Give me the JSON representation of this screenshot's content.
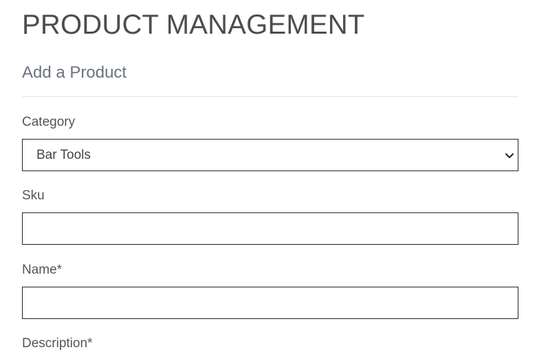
{
  "header": {
    "title": "PRODUCT MANAGEMENT"
  },
  "form": {
    "section_title": "Add a Product",
    "category": {
      "label": "Category",
      "selected_value": "Bar Tools"
    },
    "sku": {
      "label": "Sku",
      "value": ""
    },
    "name": {
      "label": "Name*",
      "value": ""
    },
    "description": {
      "label": "Description*"
    }
  },
  "icons": {
    "select_arrow": "chevron-down-icon"
  },
  "colors": {
    "title_text": "#4d4d4d",
    "section_title_text": "#6b7280",
    "label_text": "#555555",
    "input_border": "#222222",
    "divider": "#e3e3e3"
  }
}
